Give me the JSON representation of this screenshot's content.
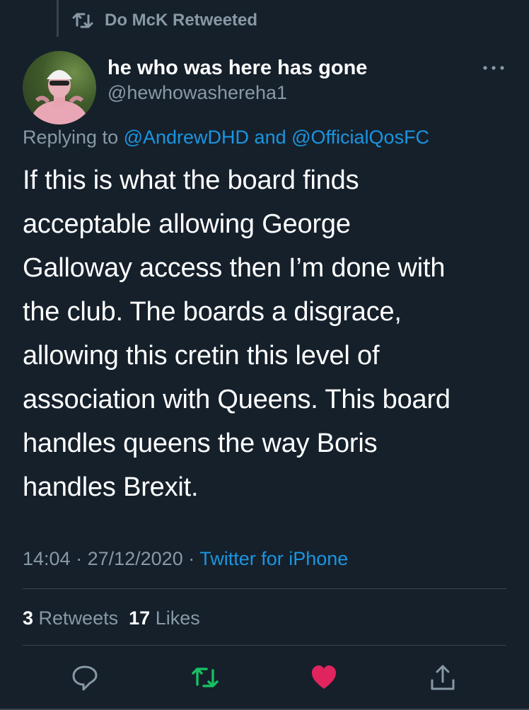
{
  "retweet_context": {
    "icon": "retweet-icon",
    "text": "Do McK Retweeted"
  },
  "author": {
    "avatar": "avatar",
    "display_name": "he who was here has gone",
    "handle": "@hewhowashereha1"
  },
  "more_icon": "more-horizontal-icon",
  "reply_to": {
    "prefix": "Replying to ",
    "user1": "@AndrewDHD",
    "conjunction": " and ",
    "user2": "@OfficialQosFC"
  },
  "tweet": {
    "text": "If this is what the board finds\nacceptable allowing George\nGalloway access then I’m done with\nthe club. The boards a disgrace,\nallowing this cretin this level of\nassociation with Queens. This board\nhandles queens the way Boris\nhandles Brexit."
  },
  "meta": {
    "time": "14:04",
    "sep1": " · ",
    "date": "27/12/2020",
    "sep2": " · ",
    "source": "Twitter for iPhone"
  },
  "stats": {
    "retweets_count": "3",
    "retweets_label": "Retweets",
    "likes_count": "17",
    "likes_label": "Likes"
  },
  "actions": [
    {
      "name": "reply-icon",
      "color": "#8899a6"
    },
    {
      "name": "retweet-icon",
      "color": "#17bf63"
    },
    {
      "name": "like-icon",
      "color": "#e0245e"
    },
    {
      "name": "share-icon",
      "color": "#8899a6"
    }
  ],
  "colors": {
    "background": "#15202b",
    "secondary_text": "#8899a6",
    "link": "#1b95e0",
    "retweeted": "#17bf63",
    "liked": "#e0245e",
    "divider": "#38444d"
  }
}
